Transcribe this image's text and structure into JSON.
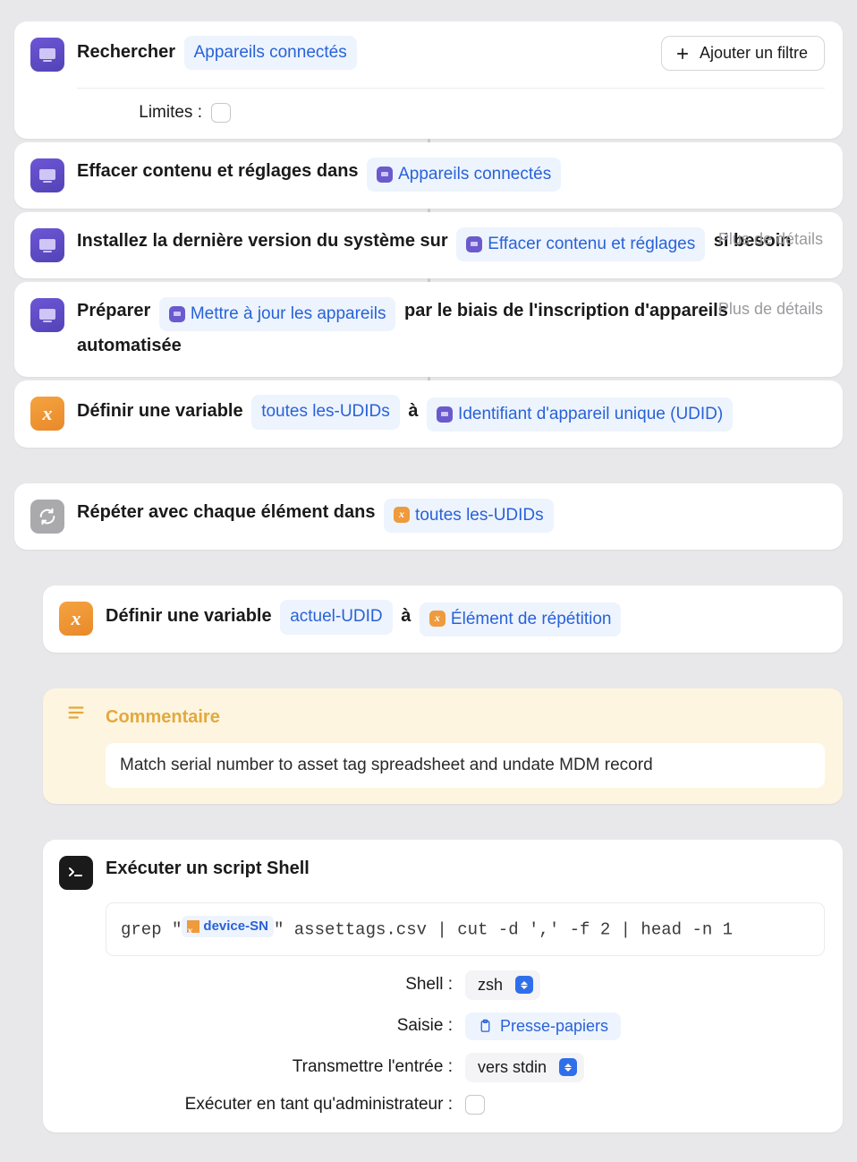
{
  "actions": {
    "search": {
      "title": "Rechercher",
      "param_token": "Appareils connectés",
      "add_filter": "Ajouter un filtre",
      "limits_label": "Limites :"
    },
    "erase": {
      "prefix": "Effacer contenu et réglages dans",
      "token": "Appareils connectés"
    },
    "install": {
      "prefix": "Installez la dernière version du système sur",
      "token": "Effacer contenu et réglages",
      "suffix": "si besoin",
      "details": "Plus de détails"
    },
    "prepare": {
      "prefix": "Préparer",
      "token": "Mettre à jour les appareils",
      "mid": "par le biais de l'inscription d'appareils automatisée",
      "details": "Plus de détails"
    },
    "setvar1": {
      "prefix": "Définir une variable",
      "name_token": "toutes les-UDIDs",
      "mid": "à",
      "value_token": "Identifiant d'appareil unique (UDID)"
    },
    "repeat": {
      "prefix": "Répéter avec chaque élément dans",
      "token": "toutes les-UDIDs"
    },
    "setvar2": {
      "prefix": "Définir une variable",
      "name_token": "actuel-UDID",
      "mid": "à",
      "value_token": "Élément de répétition"
    },
    "comment": {
      "title": "Commentaire",
      "text": "Match serial number to asset tag spreadsheet and undate MDM record"
    },
    "shell": {
      "title": "Exécuter un script Shell",
      "script_pre": "grep \"",
      "script_token": "device-SN",
      "script_post": "\" assettags.csv | cut -d ',' -f 2 | head -n 1",
      "params": {
        "shell_label": "Shell :",
        "shell_value": "zsh",
        "input_label": "Saisie :",
        "input_value": "Presse-papiers",
        "pass_label": "Transmettre l'entrée :",
        "pass_value": "vers stdin",
        "admin_label": "Exécuter en tant qu'administrateur :"
      }
    }
  }
}
